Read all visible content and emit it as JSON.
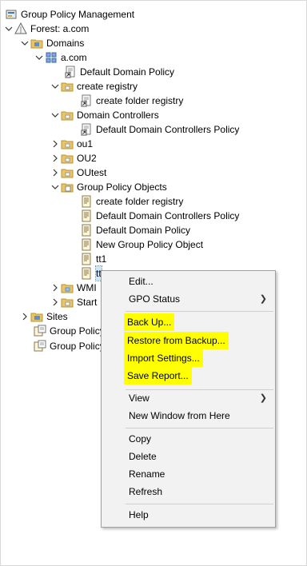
{
  "tree": {
    "root": "Group Policy Management",
    "forest": "Forest: a.com",
    "domains": "Domains",
    "domain": "a.com",
    "default_domain_policy": "Default Domain Policy",
    "create_registry": "create registry",
    "create_folder_registry": "create folder registry",
    "domain_controllers": "Domain Controllers",
    "default_dc_policy": "Default Domain Controllers Policy",
    "ou1": "ou1",
    "ou2": "OU2",
    "outest": "OUtest",
    "gpo_folder": "Group Policy Objects",
    "gpo_items": [
      "create folder registry",
      "Default Domain Controllers Policy",
      "Default Domain Policy",
      "New Group Policy Object",
      "tt1",
      "tt"
    ],
    "wmi": "WMI",
    "starter": "Start",
    "sites": "Sites",
    "gp_modeling": "Group Policy",
    "gp_results": "Group Policy"
  },
  "context_menu": {
    "edit": "Edit...",
    "gpo_status": "GPO Status",
    "back_up": "Back Up...",
    "restore": "Restore from Backup...",
    "import": "Import Settings...",
    "save_report": "Save Report...",
    "view": "View",
    "new_window": "New Window from Here",
    "copy": "Copy",
    "delete": "Delete",
    "rename": "Rename",
    "refresh": "Refresh",
    "help": "Help",
    "highlight_color": "#ffff00"
  }
}
